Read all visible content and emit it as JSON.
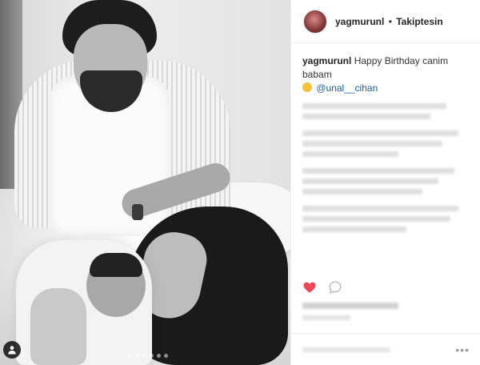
{
  "header": {
    "username": "yagmurunl",
    "separator": "•",
    "follow_status": "Takiptesin"
  },
  "caption": {
    "username": "yagmurunl",
    "text": "Happy Birthday canim babam",
    "mention": "@unal__cihan"
  },
  "icons": {
    "avatar": "profile-avatar",
    "emoji": "smiling-face-emoji",
    "like": "heart-icon",
    "comment": "comment-bubble-icon",
    "user_tag": "person-tag-icon",
    "more": "more-dots-icon"
  },
  "colors": {
    "mention": "#1c5f9a",
    "like_red": "#ed4956"
  }
}
